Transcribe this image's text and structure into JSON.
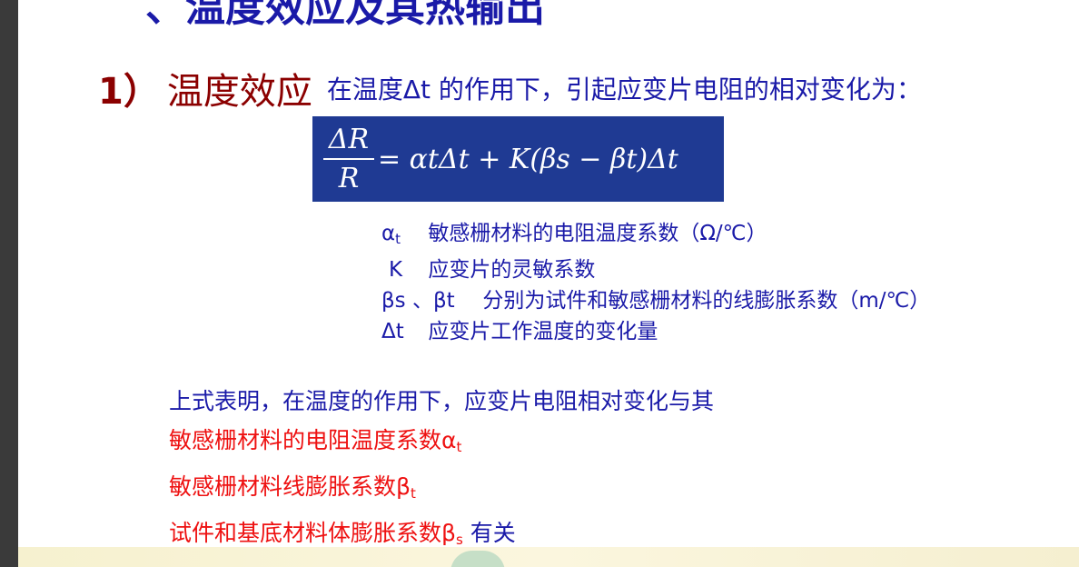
{
  "slide": {
    "cut_title": "、温度效应及其热输出",
    "heading": {
      "number": "1）",
      "title": "温度效应",
      "description": "在温度Δt 的作用下，引起应变片电阻的相对变化为："
    },
    "formula": {
      "numerator": "ΔR",
      "denominator": "R",
      "rhs": "= αtΔt + K(βs − βt)Δt"
    },
    "definitions": [
      {
        "symbol": "α",
        "sub": "t",
        "text": "敏感栅材料的电阻温度系数（Ω/℃）"
      },
      {
        "symbol": "K",
        "sub": "",
        "text": "应变片的灵敏系数"
      },
      {
        "symbol": "βs 、βt",
        "sub": "",
        "text": "分别为试件和敏感栅材料的线膨胀系数（m/℃）"
      },
      {
        "symbol": "Δt",
        "sub": "",
        "text": "应变片工作温度的变化量"
      }
    ],
    "conclusion": {
      "line1": "上式表明，在温度的作用下，应变片电阻相对变化与其",
      "line2": "敏感栅材料的电阻温度系数α",
      "line2_sub": "t",
      "line3": "敏感栅材料线膨胀系数β",
      "line3_sub": "t",
      "line4": "试件和基底材料体膨胀系数β",
      "line4_sub": "s",
      "line4_tail": " 有关"
    }
  },
  "colors": {
    "title_dark_red": "#8b0000",
    "text_blue": "#1a1aa8",
    "highlight_red": "#ee1111",
    "formula_bg": "#1f3a93"
  }
}
